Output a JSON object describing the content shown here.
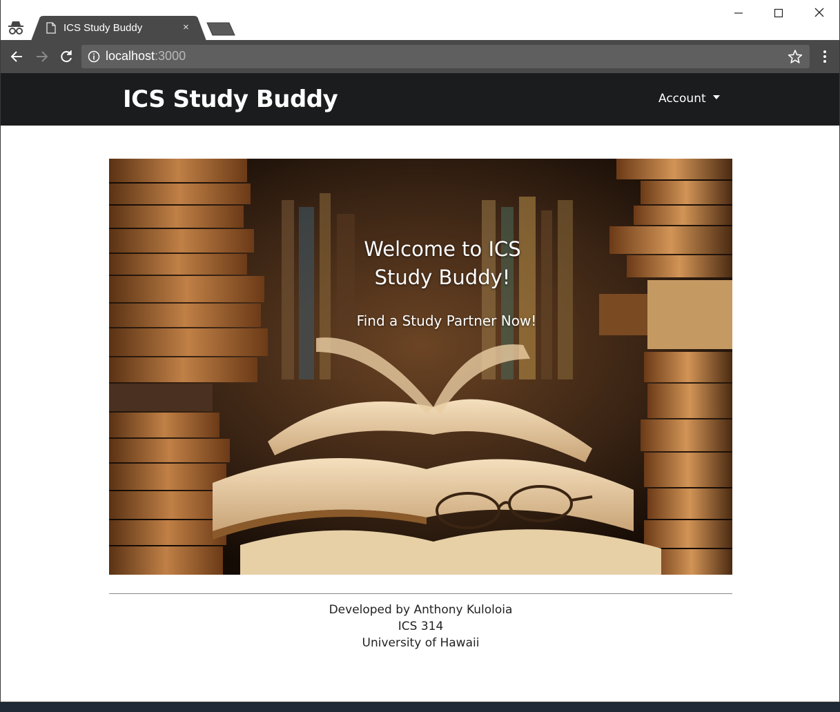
{
  "browser": {
    "tab_title": "ICS Study Buddy",
    "tab_close": "×",
    "url_host": "localhost",
    "url_port": ":3000"
  },
  "navbar": {
    "brand": "ICS Study Buddy",
    "account_label": "Account"
  },
  "hero": {
    "title_line1": "Welcome to ICS",
    "title_line2": "Study Buddy!",
    "subtitle": "Find a Study Partner Now!"
  },
  "footer": {
    "line1": "Developed by Anthony Kuloloia",
    "line2": "ICS 314",
    "line3": "University of Hawaii"
  },
  "colors": {
    "navbar_bg": "#1b1c1d",
    "toolbar_bg": "#494949",
    "tab_bg": "#494949",
    "omnibox_bg": "#5f5f5f"
  },
  "icons": [
    "incognito-icon",
    "page-icon",
    "close-icon",
    "back-icon",
    "forward-icon",
    "reload-icon",
    "info-icon",
    "star-icon",
    "more-menu-icon",
    "minimize-icon",
    "maximize-icon",
    "window-close-icon",
    "dropdown-caret-icon"
  ]
}
